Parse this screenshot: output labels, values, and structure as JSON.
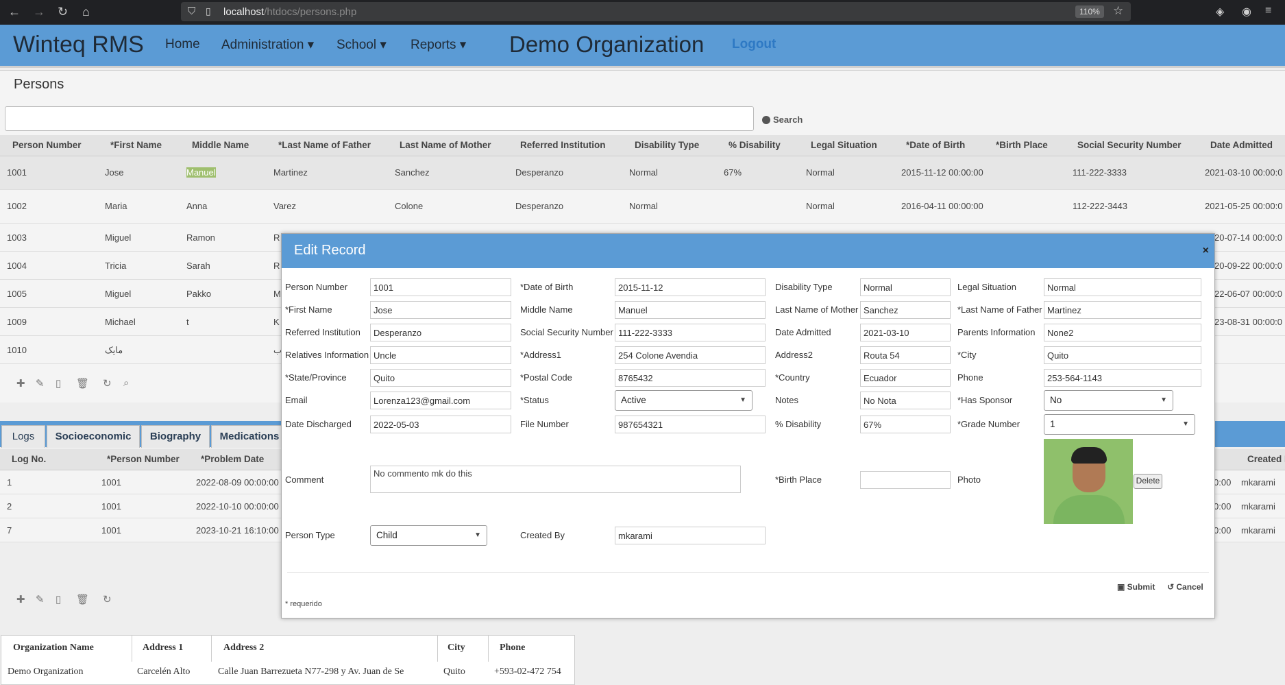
{
  "browser": {
    "url_host": "localhost",
    "url_path": "/htdocs/persons.php",
    "zoom": "110%"
  },
  "navbar": {
    "brand": "Winteq RMS",
    "items": [
      "Home",
      "Administration ▾",
      "School ▾",
      "Reports ▾"
    ],
    "org_title": "Demo Organization",
    "logout": "Logout"
  },
  "persons": {
    "title": "Persons",
    "search_label": "Search",
    "columns": [
      "Person Number",
      "*First Name",
      "Middle Name",
      "*Last Name of Father",
      "Last Name of Mother",
      "Referred Institution",
      "Disability Type",
      "% Disability",
      "Legal Situation",
      "*Date of Birth",
      "*Birth Place",
      "Social Security Number",
      "Date Admitted"
    ],
    "rows": [
      {
        "num": "1001",
        "first": "Jose",
        "middle": "Manuel",
        "father": "Martinez",
        "mother": "Sanchez",
        "inst": "Desperanzo",
        "dtype": "Normal",
        "pct": "67%",
        "legal": "Normal",
        "dob": "2015-11-12 00:00:00",
        "ssn": "111-222-3333",
        "admitted": "2021-03-10 00:00:0"
      },
      {
        "num": "1002",
        "first": "Maria",
        "middle": "Anna",
        "father": "Varez",
        "mother": "Colone",
        "inst": "Desperanzo",
        "dtype": "Normal",
        "pct": "",
        "legal": "Normal",
        "dob": "2016-04-11 00:00:00",
        "ssn": "112-222-3443",
        "admitted": "2021-05-25 00:00:0"
      },
      {
        "num": "1003",
        "first": "Miguel",
        "middle": "Ramon",
        "father": "R",
        "admitted": "20-07-14 00:00:0"
      },
      {
        "num": "1004",
        "first": "Tricia",
        "middle": "Sarah",
        "father": "R",
        "admitted": "20-09-22 00:00:0"
      },
      {
        "num": "1005",
        "first": "Miguel",
        "middle": "Pakko",
        "father": "M",
        "admitted": "22-06-07 00:00:0"
      },
      {
        "num": "1009",
        "first": "Michael",
        "middle": "t",
        "father": "K",
        "admitted": "23-08-31 00:00:0"
      },
      {
        "num": "1010",
        "first": "مايک",
        "middle": "",
        "father": "ب",
        "admitted": ""
      }
    ]
  },
  "subtabs": {
    "tabs": [
      "Logs",
      "Socioeconomic",
      "Biography",
      "Medications"
    ],
    "columns": [
      "Log No.",
      "*Person Number",
      "*Problem Date",
      "Created B"
    ],
    "rows": [
      {
        "no": "1",
        "person": "1001",
        "date": "2022-08-09 00:00:00",
        "tail": "0:00",
        "by": "mkarami"
      },
      {
        "no": "2",
        "person": "1001",
        "date": "2022-10-10 00:00:00",
        "tail": "0:00",
        "by": "mkarami"
      },
      {
        "no": "7",
        "person": "1001",
        "date": "2023-10-21 16:10:00",
        "tail": "0:00",
        "by": "mkarami"
      }
    ]
  },
  "org_table": {
    "columns": [
      "Organization Name",
      "Address 1",
      "Address 2",
      "City",
      "Phone"
    ],
    "row": [
      "Demo Organization",
      "Carcelén Alto",
      "Calle Juan Barrezueta N77-298 y Av. Juan de Se",
      "Quito",
      "+593-02-472 754"
    ]
  },
  "modal": {
    "title": "Edit Record",
    "close": "×",
    "fields": {
      "person_number": {
        "label": "Person Number",
        "value": "1001"
      },
      "first_name": {
        "label": "*First Name",
        "value": "Jose"
      },
      "referred_institution": {
        "label": "Referred Institution",
        "value": "Desperanzo"
      },
      "relatives_information": {
        "label": "Relatives Information",
        "value": "Uncle"
      },
      "state": {
        "label": "*State/Province",
        "value": "Quito"
      },
      "email": {
        "label": "Email",
        "value": "Lorenza123@gmail.com"
      },
      "date_discharged": {
        "label": "Date Discharged",
        "value": "2022-05-03"
      },
      "date_of_birth": {
        "label": "*Date of Birth",
        "value": "2015-11-12"
      },
      "middle_name": {
        "label": "Middle Name",
        "value": "Manuel"
      },
      "ssn": {
        "label": "Social Security Number",
        "value": "111-222-3333"
      },
      "address1": {
        "label": "*Address1",
        "value": "254 Colone Avendia"
      },
      "postal_code": {
        "label": "*Postal Code",
        "value": "8765432"
      },
      "status": {
        "label": "*Status",
        "value": "Active"
      },
      "file_number": {
        "label": "File Number",
        "value": "987654321"
      },
      "disability_type": {
        "label": "Disability Type",
        "value": "Normal"
      },
      "mother": {
        "label": "Last Name of Mother",
        "value": "Sanchez"
      },
      "date_admitted": {
        "label": "Date Admitted",
        "value": "2021-03-10"
      },
      "address2": {
        "label": "Address2",
        "value": "Routa 54"
      },
      "country": {
        "label": "*Country",
        "value": "Ecuador"
      },
      "notes": {
        "label": "Notes",
        "value": "No Nota"
      },
      "pct_disability": {
        "label": "% Disability",
        "value": "67%"
      },
      "legal_situation": {
        "label": "Legal Situation",
        "value": "Normal"
      },
      "father": {
        "label": "*Last Name of Father",
        "value": "Martinez"
      },
      "parents_information": {
        "label": "Parents Information",
        "value": "None2"
      },
      "city": {
        "label": "*City",
        "value": "Quito"
      },
      "phone": {
        "label": "Phone",
        "value": "253-564-1143"
      },
      "has_sponsor": {
        "label": "*Has Sponsor",
        "value": "No"
      },
      "grade_number": {
        "label": "*Grade Number",
        "value": "1"
      },
      "comment": {
        "label": "Comment",
        "value": "No commento mk do this"
      },
      "birth_place": {
        "label": "*Birth Place",
        "value": ""
      },
      "photo": {
        "label": "Photo",
        "delete": "Delete"
      },
      "person_type": {
        "label": "Person Type",
        "value": "Child"
      },
      "created_by": {
        "label": "Created By",
        "value": "mkarami"
      }
    },
    "submit": "Submit",
    "cancel": "Cancel",
    "required_note": "* requerido"
  }
}
